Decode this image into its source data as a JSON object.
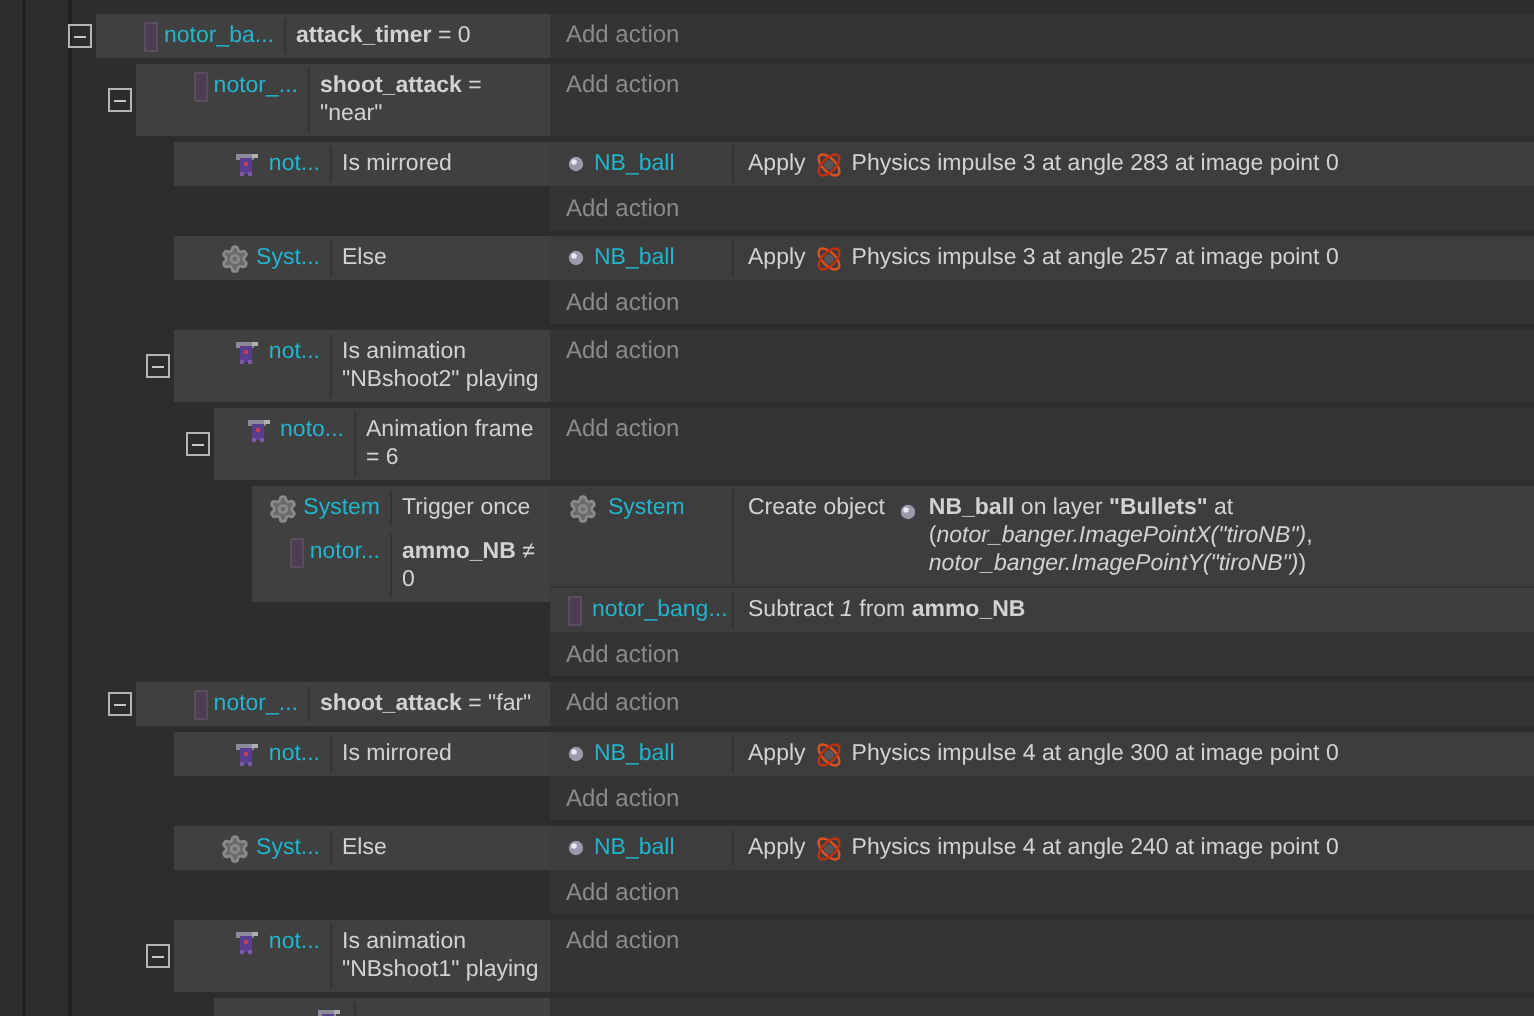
{
  "events": [
    {
      "expanded": true,
      "conditions": [
        {
          "kind": "variable",
          "object": "notor_ba...",
          "text": "**attack_timer** = 0"
        }
      ],
      "add_action": "Add action",
      "children": [
        {
          "expanded": true,
          "conditions": [
            {
              "kind": "variable",
              "object": "notor_...",
              "text": "**shoot_attack** = \"near\""
            }
          ],
          "add_action": "Add action",
          "children": [
            {
              "conditions": [
                {
                  "kind": "sprite",
                  "object": "not...",
                  "text": "Is mirrored"
                }
              ],
              "actions": [
                {
                  "kind": "physics",
                  "object": "NB_ball",
                  "verb": "Apply",
                  "text": "Physics impulse 3 at angle 283 at image point 0"
                }
              ],
              "add_action": "Add action"
            },
            {
              "conditions": [
                {
                  "kind": "system",
                  "object": "Syst...",
                  "text": "Else"
                }
              ],
              "actions": [
                {
                  "kind": "physics",
                  "object": "NB_ball",
                  "verb": "Apply",
                  "text": "Physics impulse 3 at angle 257 at image point 0"
                }
              ],
              "add_action": "Add action"
            },
            {
              "expanded": true,
              "conditions": [
                {
                  "kind": "sprite",
                  "object": "not...",
                  "text": "Is animation \"NBshoot2\" playing"
                }
              ],
              "add_action": "Add action",
              "children": [
                {
                  "expanded": true,
                  "conditions": [
                    {
                      "kind": "sprite",
                      "object": "noto...",
                      "text": "Animation frame = 6"
                    }
                  ],
                  "add_action": "Add action",
                  "children": [
                    {
                      "conditions": [
                        {
                          "kind": "system",
                          "object": "System",
                          "text": "Trigger once"
                        },
                        {
                          "kind": "variable",
                          "object": "notor...",
                          "text": "**ammo_NB** ≠ 0"
                        }
                      ],
                      "actions": [
                        {
                          "kind": "create",
                          "object": "System",
                          "verb": "Create object",
                          "text": "**NB_ball** on layer **\"Bullets\"** at (*notor_banger.ImagePointX(\"tiroNB\")*, *notor_banger.ImagePointY(\"tiroNB\")*)"
                        },
                        {
                          "kind": "variable",
                          "object": "notor_bang...",
                          "text": "Subtract *1* from **ammo_NB**"
                        }
                      ],
                      "add_action": "Add action"
                    }
                  ]
                }
              ]
            }
          ]
        },
        {
          "expanded": true,
          "conditions": [
            {
              "kind": "variable",
              "object": "notor_...",
              "text": "**shoot_attack** = \"far\""
            }
          ],
          "add_action": "Add action",
          "children": [
            {
              "conditions": [
                {
                  "kind": "sprite",
                  "object": "not...",
                  "text": "Is mirrored"
                }
              ],
              "actions": [
                {
                  "kind": "physics",
                  "object": "NB_ball",
                  "verb": "Apply",
                  "text": "Physics impulse 4 at angle 300 at image point 0"
                }
              ],
              "add_action": "Add action"
            },
            {
              "conditions": [
                {
                  "kind": "system",
                  "object": "Syst...",
                  "text": "Else"
                }
              ],
              "actions": [
                {
                  "kind": "physics",
                  "object": "NB_ball",
                  "verb": "Apply",
                  "text": "Physics impulse 4 at angle 240 at image point 0"
                }
              ],
              "add_action": "Add action"
            },
            {
              "expanded": true,
              "conditions": [
                {
                  "kind": "sprite",
                  "object": "not...",
                  "text": "Is animation \"NBshoot1\" playing"
                }
              ],
              "add_action": "Add action",
              "children": [
                {
                  "conditions": [
                    {
                      "kind": "sprite"
                    }
                  ]
                }
              ]
            }
          ]
        }
      ]
    }
  ]
}
